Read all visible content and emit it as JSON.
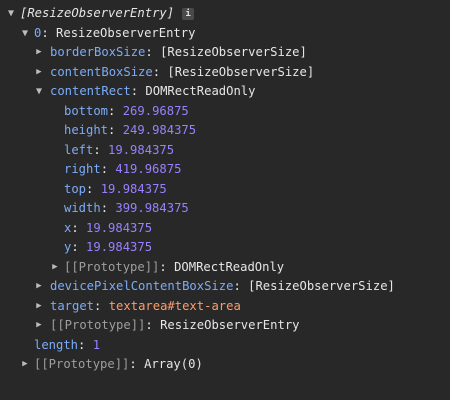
{
  "header": {
    "text": "[ResizeObserverEntry]",
    "info_glyph": "i"
  },
  "entry": {
    "index": "0",
    "type": "ResizeObserverEntry",
    "borderBoxSize": {
      "key": "borderBoxSize",
      "value": "[ResizeObserverSize]"
    },
    "contentBoxSize": {
      "key": "contentBoxSize",
      "value": "[ResizeObserverSize]"
    },
    "contentRect": {
      "key": "contentRect",
      "value": "DOMRectReadOnly",
      "props": [
        {
          "key": "bottom",
          "value": "269.96875"
        },
        {
          "key": "height",
          "value": "249.984375"
        },
        {
          "key": "left",
          "value": "19.984375"
        },
        {
          "key": "right",
          "value": "419.96875"
        },
        {
          "key": "top",
          "value": "19.984375"
        },
        {
          "key": "width",
          "value": "399.984375"
        },
        {
          "key": "x",
          "value": "19.984375"
        },
        {
          "key": "y",
          "value": "19.984375"
        }
      ],
      "prototype": {
        "key": "[[Prototype]]",
        "value": "DOMRectReadOnly"
      }
    },
    "devicePixelContentBoxSize": {
      "key": "devicePixelContentBoxSize",
      "value": "[ResizeObserverSize]"
    },
    "target": {
      "key": "target",
      "value": "textarea#text-area"
    },
    "prototype": {
      "key": "[[Prototype]]",
      "value": "ResizeObserverEntry"
    }
  },
  "length": {
    "key": "length",
    "value": "1"
  },
  "array_prototype": {
    "key": "[[Prototype]]",
    "value": "Array(0)"
  }
}
